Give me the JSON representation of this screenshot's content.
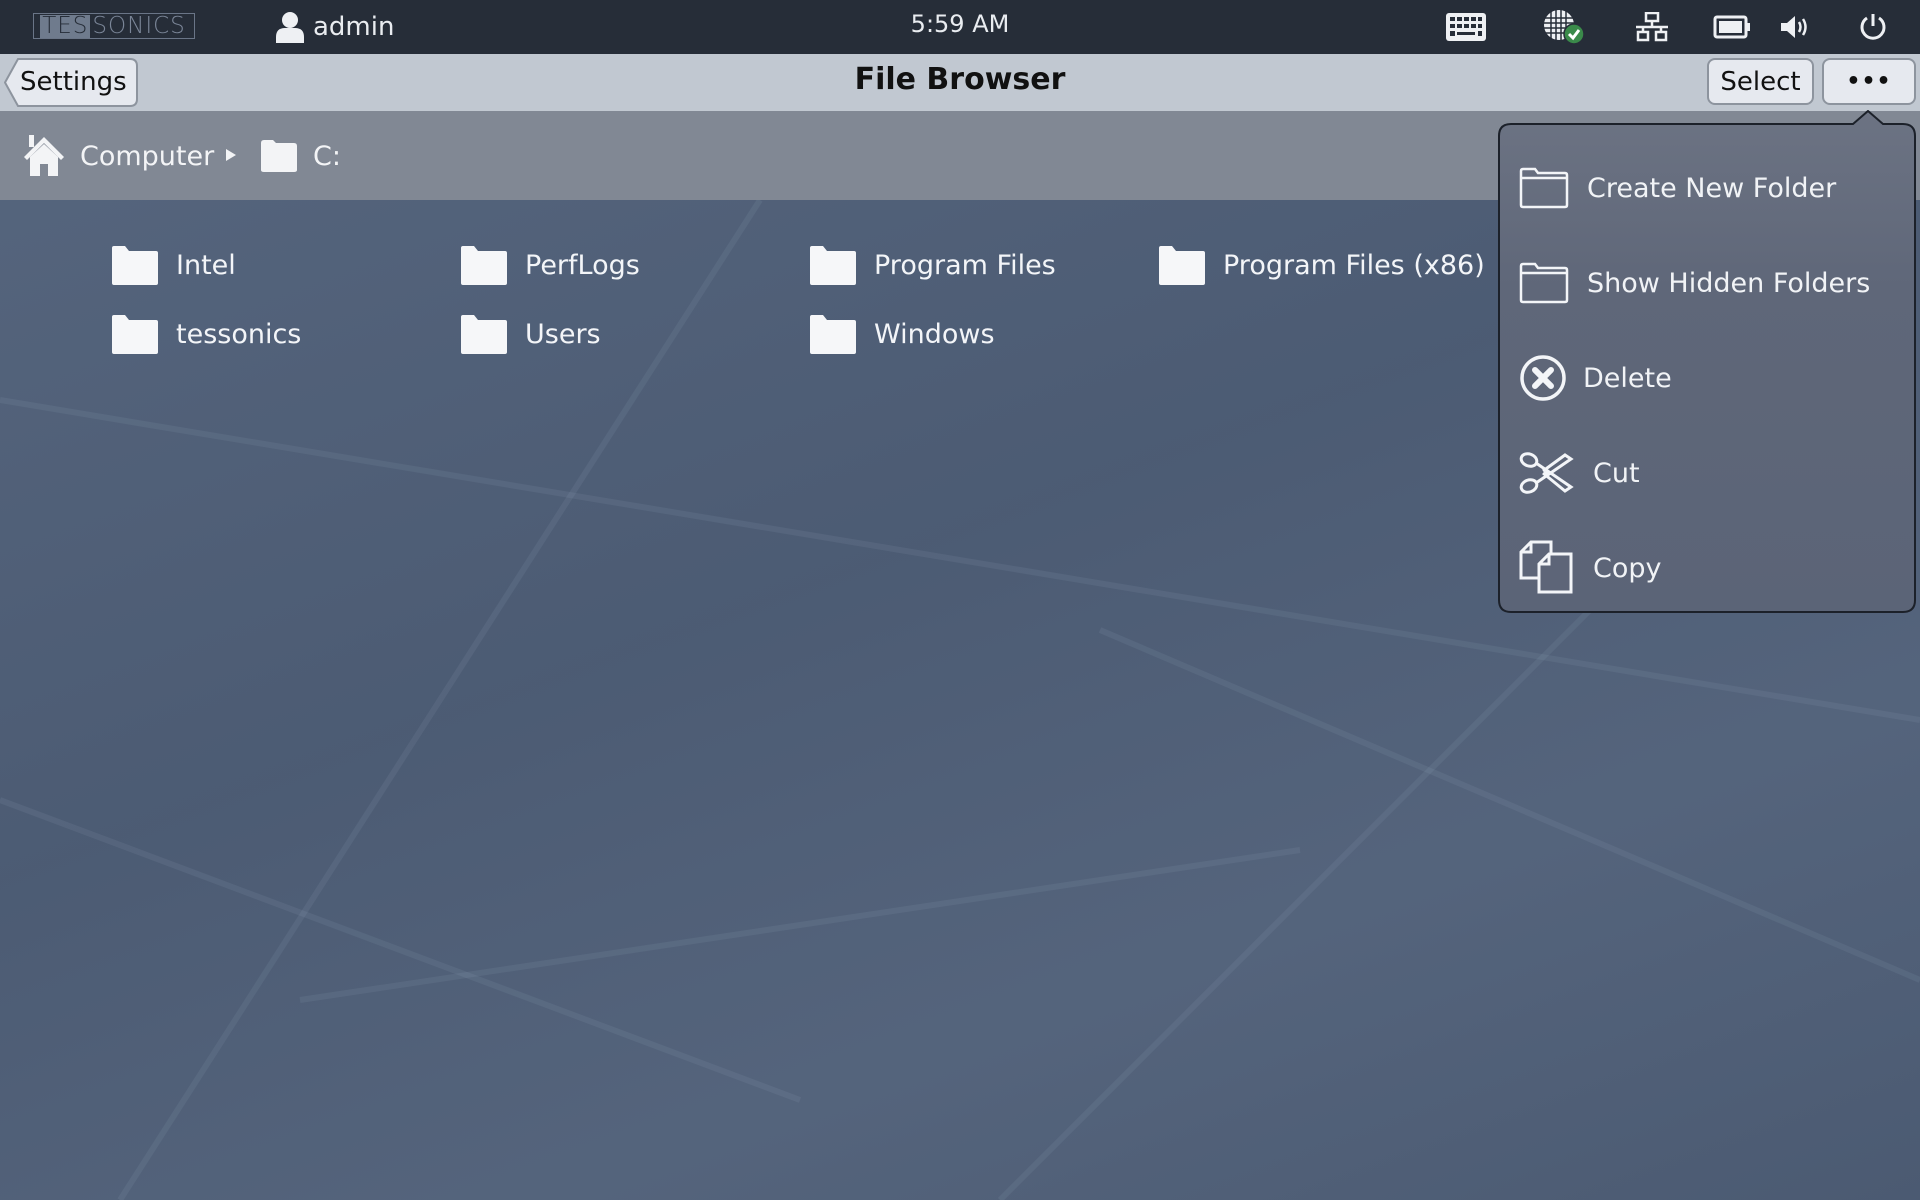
{
  "topbar": {
    "logo": {
      "part1": "TES",
      "part2": "SONICS"
    },
    "user": {
      "icon": "user-icon",
      "name": "admin"
    },
    "clock": "5:59 AM",
    "tray_icons": [
      "keyboard-icon",
      "globe-connected-icon",
      "network-icon",
      "battery-icon",
      "volume-icon",
      "power-icon"
    ]
  },
  "titlebar": {
    "back_label": "Settings",
    "title": "File Browser",
    "select_label": "Select",
    "more_label": "•••"
  },
  "breadcrumb": {
    "items": [
      {
        "icon": "home-icon",
        "label": "Computer"
      },
      {
        "icon": "folder-icon",
        "label": "C:"
      }
    ],
    "separator": "chevron-right-icon"
  },
  "folders": [
    {
      "name": "Intel"
    },
    {
      "name": "PerfLogs"
    },
    {
      "name": "Program Files"
    },
    {
      "name": "Program Files (x86)"
    },
    {
      "name": "tessonics"
    },
    {
      "name": "Users"
    },
    {
      "name": "Windows"
    }
  ],
  "menu": {
    "items": [
      {
        "icon": "folder-outline-icon",
        "label": "Create New Folder"
      },
      {
        "icon": "folder-outline-icon",
        "label": "Show Hidden Folders"
      },
      {
        "icon": "delete-circle-icon",
        "label": "Delete"
      },
      {
        "icon": "scissors-icon",
        "label": "Cut"
      },
      {
        "icon": "copy-icon",
        "label": "Copy"
      }
    ]
  },
  "colors": {
    "topbar_bg": "#262d38",
    "titlebar_bg": "#c1c8d1",
    "breadcrumb_bg": "#818894",
    "desktop_bg": "#4f5f78",
    "popup_bg": "#5e6779",
    "status_ok": "#3a8a4a"
  }
}
